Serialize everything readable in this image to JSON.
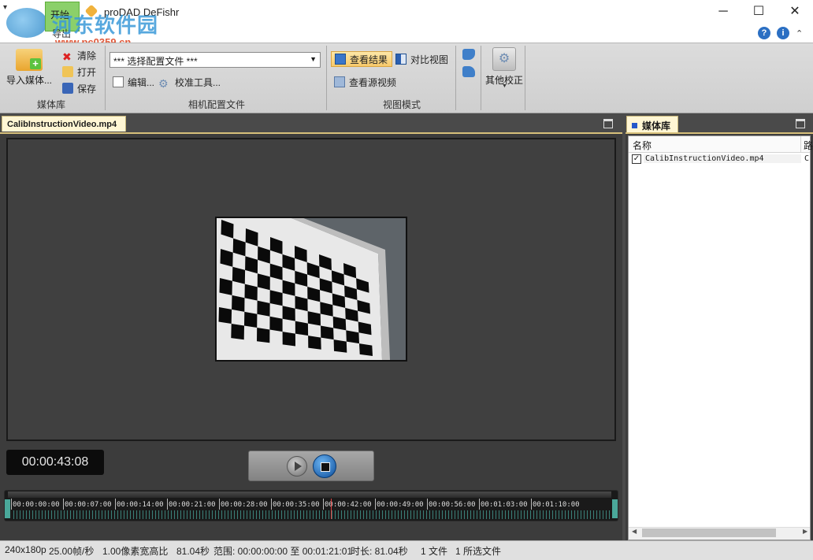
{
  "title_bar": {
    "tab_start": "开始",
    "tab_export": "导出",
    "app_title": "proDAD DeFishr",
    "watermark_site": "河东软件园",
    "watermark_url": "www.pc0359.cn",
    "minimize": "─",
    "maximize": "☐",
    "close": "✕",
    "help": "?",
    "info": "i",
    "collapse": "⌃"
  },
  "ribbon": {
    "media_group_label": "媒体库",
    "import_label": "导入媒体...",
    "clear_label": "清除",
    "open_label": "打开",
    "save_label": "保存",
    "camera_group_label": "相机配置文件",
    "profile_select_value": "*** 选择配置文件 ***",
    "edit_label": "编辑...",
    "calibrate_label": "校准工具...",
    "view_group_label": "视图模式",
    "view_result_label": "查看结果",
    "compare_view_label": "对比视图",
    "view_source_label": "查看源视频",
    "other_calibration_label": "其他校正"
  },
  "main_panel": {
    "tab_title": "CalibInstructionVideo.mp4",
    "timecode": "00:00:43:08",
    "timeline_ticks": [
      "00:00:00:00",
      "00:00:07:00",
      "00:00:14:00",
      "00:00:21:00",
      "00:00:28:00",
      "00:00:35:00",
      "00:00:42:00",
      "00:00:49:00",
      "00:00:56:00",
      "00:01:03:00",
      "00:01:10:00"
    ]
  },
  "library_panel": {
    "tab_title": "媒体库",
    "column_name": "名称",
    "column_path": "路",
    "items": [
      {
        "checked": true,
        "name": "CalibInstructionVideo.mp4",
        "path": "C"
      }
    ]
  },
  "status_bar": {
    "resolution": "240x180p",
    "fps": "25.00帧/秒",
    "aspect": "1.00像素宽高比",
    "duration_sec": "81.04秒",
    "range": "范围: 00:00:00:00 至 00:01:21:01",
    "length": "时长: 81.04秒",
    "files": "1 文件",
    "selected": "1 所选文件"
  },
  "colors": {
    "accent_tab": "#fff6d4",
    "active_ribbon_tab": "#8bd06a",
    "timeline_marker": "#e04040",
    "stop_button": "#0a4b9a"
  }
}
